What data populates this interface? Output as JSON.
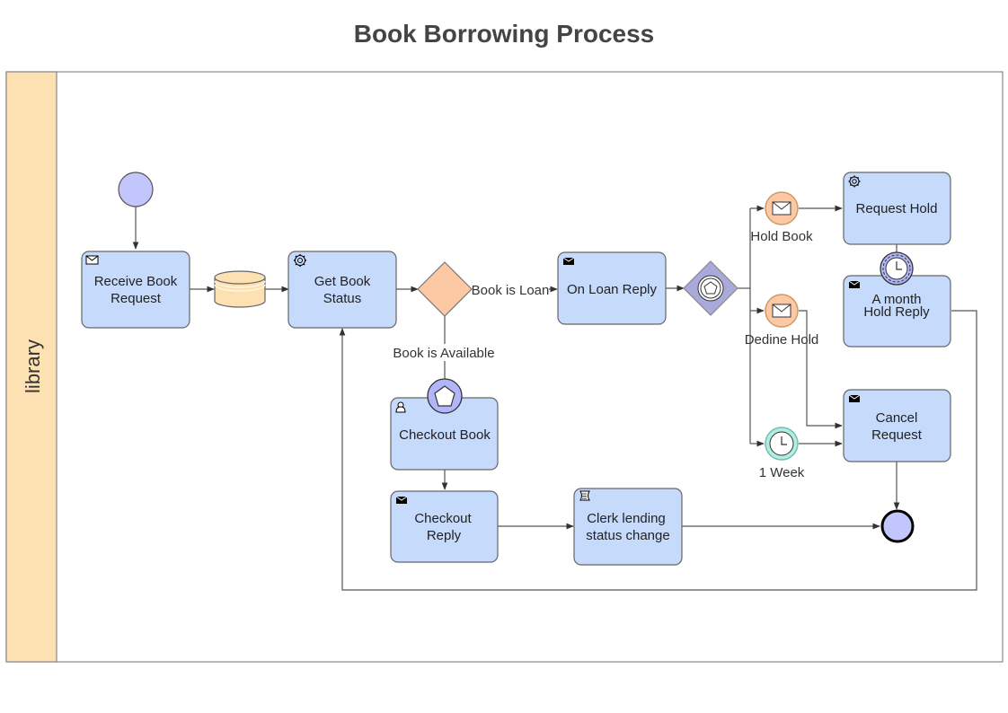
{
  "title": "Book Borrowing Process",
  "pool": {
    "lane_label": "library",
    "lane_color": "#fde1b3"
  },
  "colors": {
    "task_fill": "#c6dafc",
    "task_stroke": "#666666",
    "start_fill": "#c2c6fd",
    "gateway_exclusive_fill": "#fdc9a5",
    "gateway_event_fill": "#a9aad9",
    "message_event_fill": "#fdc9a5",
    "timer_event_fill": "#b2eedf",
    "data_store_fill": "#fde1b3",
    "boundary_event_fill": "#b1b6f8"
  },
  "nodes": {
    "start": {
      "label": ""
    },
    "receive_book_request": {
      "label_line1": "Receive Book",
      "label_line2": "Request",
      "icon": "envelope-outline-icon"
    },
    "data_store": {
      "label": ""
    },
    "get_book_status": {
      "label_line1": "Get Book",
      "label_line2": "Status",
      "icon": "gear-icon"
    },
    "gateway_exclusive": {
      "label": ""
    },
    "on_loan_reply": {
      "label": "On Loan Reply",
      "icon": "envelope-filled-icon"
    },
    "gateway_event": {
      "label": ""
    },
    "hold_book_event": {
      "label": "Hold Book",
      "icon": "envelope-outline-icon"
    },
    "decline_hold_event": {
      "label": "Dedine Hold",
      "icon": "envelope-outline-icon"
    },
    "one_week_timer": {
      "label": "1 Week",
      "icon": "clock-icon"
    },
    "request_hold": {
      "label": "Request Hold",
      "icon": "gear-icon"
    },
    "month_hold_reply": {
      "label_line1": "A month",
      "label_line2": "Hold Reply",
      "icon": "envelope-filled-icon"
    },
    "month_timer_boundary": {
      "icon": "clock-icon"
    },
    "cancel_request": {
      "label_line1": "Cancel",
      "label_line2": "Request",
      "icon": "envelope-filled-icon"
    },
    "checkout_book": {
      "label": "Checkout Book",
      "icon": "user-icon"
    },
    "checkout_boundary": {
      "icon": "pentagon-icon"
    },
    "checkout_reply": {
      "label_line1": "Checkout",
      "label_line2": "Reply",
      "icon": "envelope-filled-icon"
    },
    "clerk_lending": {
      "label_line1": "Clerk lending",
      "label_line2": "status change",
      "icon": "script-icon"
    },
    "end": {
      "label": ""
    }
  },
  "flows": {
    "book_is_loan": "Book is Loan",
    "book_is_available": "Book is Available"
  }
}
